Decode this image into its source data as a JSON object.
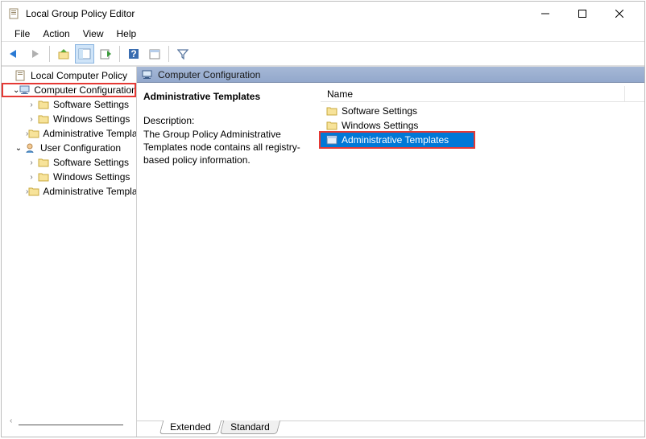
{
  "window": {
    "title": "Local Group Policy Editor"
  },
  "menu": {
    "items": [
      "File",
      "Action",
      "View",
      "Help"
    ]
  },
  "tree": {
    "root": "Local Computer Policy",
    "nodes": [
      {
        "label": "Computer Configuration",
        "children": [
          "Software Settings",
          "Windows Settings",
          "Administrative Templates"
        ]
      },
      {
        "label": "User Configuration",
        "children": [
          "Software Settings",
          "Windows Settings",
          "Administrative Templates"
        ]
      }
    ]
  },
  "details": {
    "header": "Computer Configuration",
    "section_title": "Administrative Templates",
    "description_label": "Description:",
    "description_text": "The Group Policy Administrative Templates node contains all registry-based policy information.",
    "list_header": "Name",
    "items": [
      {
        "name": "Software Settings",
        "selected": false
      },
      {
        "name": "Windows Settings",
        "selected": false
      },
      {
        "name": "Administrative Templates",
        "selected": true
      }
    ]
  },
  "tabs": {
    "extended": "Extended",
    "standard": "Standard"
  }
}
